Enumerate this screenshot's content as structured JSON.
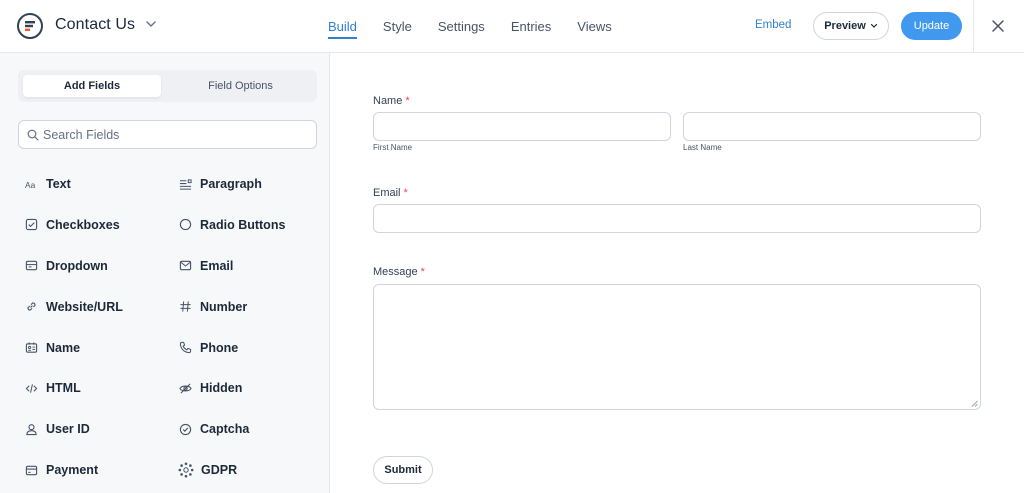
{
  "header": {
    "form_title": "Contact Us",
    "tabs": [
      {
        "label": "Build",
        "active": true
      },
      {
        "label": "Style",
        "active": false
      },
      {
        "label": "Settings",
        "active": false
      },
      {
        "label": "Entries",
        "active": false
      },
      {
        "label": "Views",
        "active": false
      }
    ],
    "embed_label": "Embed",
    "preview_label": "Preview",
    "update_label": "Update"
  },
  "sidebar": {
    "panel_tabs": [
      "Add Fields",
      "Field Options"
    ],
    "search_placeholder": "Search Fields",
    "fields": [
      {
        "label": "Text",
        "icon": "text-icon"
      },
      {
        "label": "Paragraph",
        "icon": "paragraph-icon"
      },
      {
        "label": "Checkboxes",
        "icon": "checkbox-icon"
      },
      {
        "label": "Radio Buttons",
        "icon": "radio-icon"
      },
      {
        "label": "Dropdown",
        "icon": "dropdown-icon"
      },
      {
        "label": "Email",
        "icon": "email-icon"
      },
      {
        "label": "Website/URL",
        "icon": "link-icon"
      },
      {
        "label": "Number",
        "icon": "hash-icon"
      },
      {
        "label": "Name",
        "icon": "name-card-icon"
      },
      {
        "label": "Phone",
        "icon": "phone-icon"
      },
      {
        "label": "HTML",
        "icon": "code-icon"
      },
      {
        "label": "Hidden",
        "icon": "eye-off-icon"
      },
      {
        "label": "User ID",
        "icon": "user-icon"
      },
      {
        "label": "Captcha",
        "icon": "shield-check-icon"
      },
      {
        "label": "Payment",
        "icon": "credit-card-icon"
      },
      {
        "label": "GDPR",
        "icon": "gdpr-stars-icon"
      }
    ]
  },
  "form": {
    "name_label": "Name",
    "required_mark": "*",
    "first_name_sub": "First Name",
    "last_name_sub": "Last Name",
    "email_label": "Email",
    "message_label": "Message",
    "submit_label": "Submit"
  },
  "colors": {
    "accent": "#2f80d1",
    "update_button": "#4199ef",
    "required": "#e5484d",
    "sidebar_bg": "#f7f8fa",
    "border": "#d0d5dd"
  }
}
